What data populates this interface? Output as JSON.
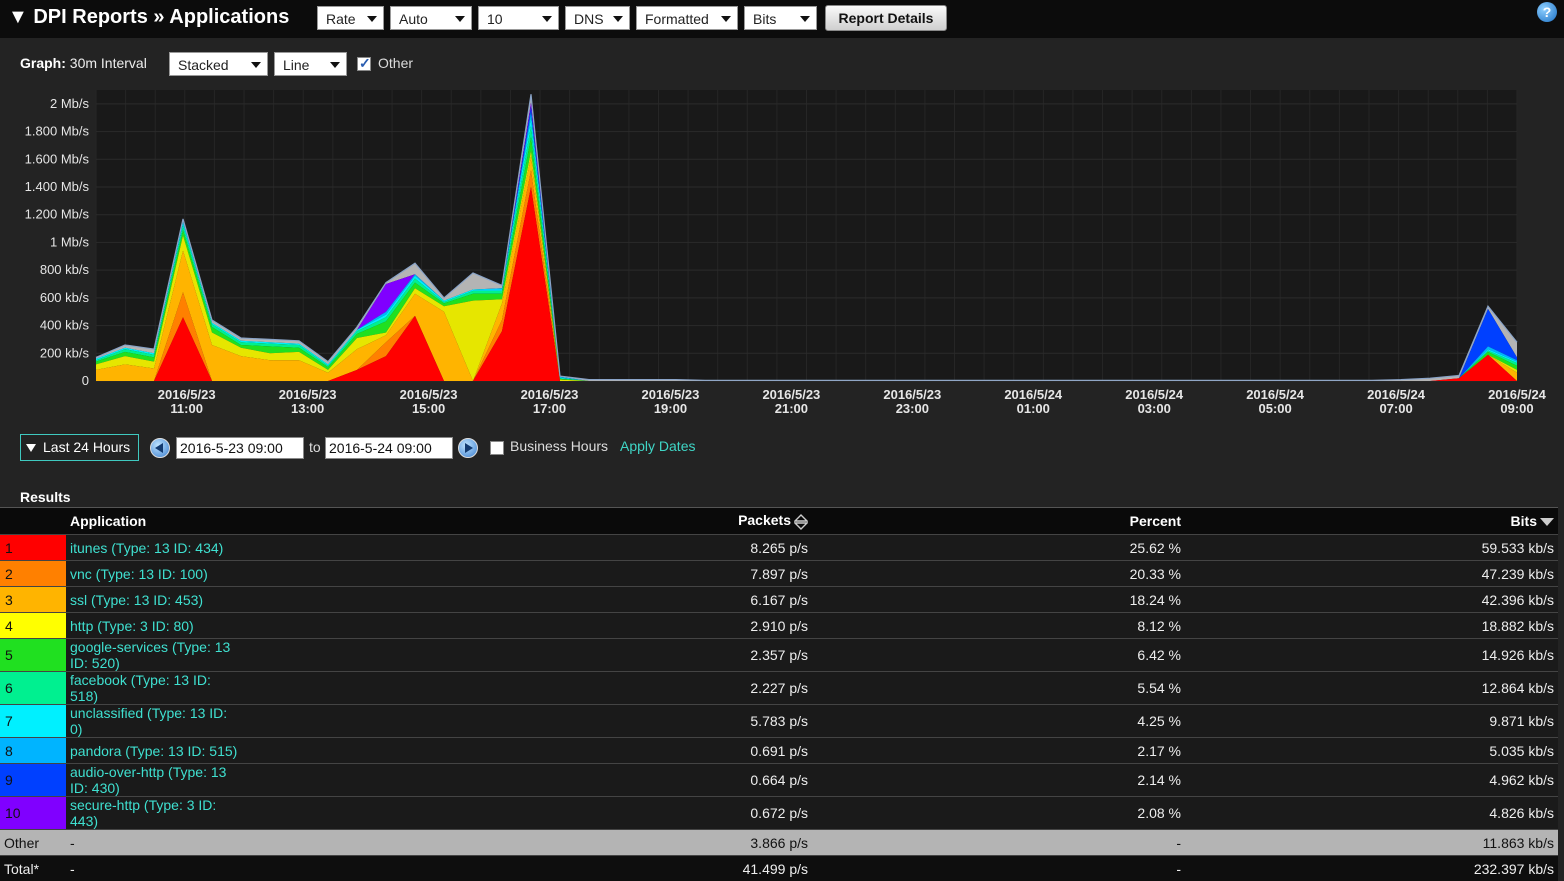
{
  "header": {
    "title": "▼ DPI Reports » Applications",
    "selects": [
      "Rate",
      "Auto",
      "10",
      "DNS",
      "Formatted",
      "Bits"
    ],
    "report_button": "Report Details",
    "help": "?"
  },
  "graph_controls": {
    "label": "Graph:",
    "interval": "30m Interval",
    "mode": "Stacked",
    "style": "Line",
    "other_checked": true,
    "other_label": "Other"
  },
  "chart_data": {
    "type": "area",
    "stacked": true,
    "y_unit": "bits/s",
    "ylim": [
      0,
      2100000
    ],
    "yticks": [
      "2 Mb/s",
      "1.800 Mb/s",
      "1.600 Mb/s",
      "1.400 Mb/s",
      "1.200 Mb/s",
      "1 Mb/s",
      "800 kb/s",
      "600 kb/s",
      "400 kb/s",
      "200 kb/s",
      "0"
    ],
    "ytick_values": [
      2000000,
      1800000,
      1600000,
      1400000,
      1200000,
      1000000,
      800000,
      600000,
      400000,
      200000,
      0
    ],
    "xticks": [
      {
        "date": "2016/5/23",
        "time": "11:00"
      },
      {
        "date": "2016/5/23",
        "time": "13:00"
      },
      {
        "date": "2016/5/23",
        "time": "15:00"
      },
      {
        "date": "2016/5/23",
        "time": "17:00"
      },
      {
        "date": "2016/5/23",
        "time": "19:00"
      },
      {
        "date": "2016/5/23",
        "time": "21:00"
      },
      {
        "date": "2016/5/23",
        "time": "23:00"
      },
      {
        "date": "2016/5/24",
        "time": "01:00"
      },
      {
        "date": "2016/5/24",
        "time": "03:00"
      },
      {
        "date": "2016/5/24",
        "time": "05:00"
      },
      {
        "date": "2016/5/24",
        "time": "07:00"
      },
      {
        "date": "2016/5/24",
        "time": "09:00"
      }
    ],
    "x_start": "2016-05-23 09:30",
    "x_end": "2016-05-24 09:00",
    "grid": true,
    "series": [
      {
        "name": "itunes",
        "color": "#ff0000",
        "values": [
          0,
          0,
          0,
          460000,
          0,
          0,
          0,
          0,
          0,
          80000,
          180000,
          470000,
          0,
          0,
          360000,
          1400000,
          0,
          0,
          0,
          0,
          0,
          0,
          0,
          0,
          0,
          0,
          0,
          0,
          0,
          0,
          0,
          0,
          0,
          0,
          0,
          0,
          0,
          0,
          0,
          0,
          0,
          0,
          0,
          0,
          0,
          0,
          0,
          20000,
          190000,
          0
        ]
      },
      {
        "name": "vnc",
        "color": "#ff8000",
        "values": [
          0,
          0,
          0,
          180000,
          0,
          0,
          0,
          0,
          0,
          0,
          100000,
          0,
          0,
          0,
          80000,
          120000,
          0,
          0,
          0,
          0,
          0,
          0,
          0,
          0,
          0,
          0,
          0,
          0,
          0,
          0,
          0,
          0,
          0,
          0,
          0,
          0,
          0,
          0,
          0,
          0,
          0,
          0,
          0,
          0,
          0,
          0,
          0,
          0,
          0,
          0
        ]
      },
      {
        "name": "ssl",
        "color": "#ffb400",
        "values": [
          80000,
          120000,
          90000,
          300000,
          260000,
          180000,
          150000,
          150000,
          60000,
          150000,
          50000,
          160000,
          500000,
          0,
          120000,
          100000,
          0,
          0,
          0,
          0,
          0,
          0,
          0,
          0,
          0,
          0,
          0,
          0,
          0,
          0,
          0,
          0,
          0,
          0,
          0,
          0,
          0,
          0,
          0,
          0,
          0,
          0,
          0,
          0,
          0,
          0,
          0,
          0,
          0,
          60000
        ]
      },
      {
        "name": "http",
        "color": "#e6e600",
        "values": [
          40000,
          60000,
          50000,
          110000,
          90000,
          60000,
          50000,
          60000,
          20000,
          80000,
          20000,
          40000,
          40000,
          580000,
          30000,
          40000,
          10000,
          0,
          0,
          0,
          0,
          0,
          0,
          0,
          0,
          0,
          0,
          0,
          0,
          0,
          0,
          0,
          0,
          0,
          0,
          0,
          0,
          0,
          0,
          0,
          0,
          0,
          0,
          0,
          0,
          0,
          0,
          0,
          0,
          20000
        ]
      },
      {
        "name": "google-services",
        "color": "#20e020",
        "values": [
          20000,
          30000,
          30000,
          40000,
          40000,
          20000,
          50000,
          30000,
          20000,
          30000,
          80000,
          40000,
          20000,
          50000,
          40000,
          100000,
          5000,
          0,
          0,
          0,
          0,
          0,
          0,
          0,
          0,
          0,
          0,
          0,
          0,
          0,
          0,
          0,
          0,
          0,
          0,
          0,
          0,
          0,
          0,
          0,
          0,
          0,
          0,
          0,
          0,
          0,
          0,
          0,
          20000,
          30000
        ]
      },
      {
        "name": "facebook",
        "color": "#00f090",
        "values": [
          10000,
          20000,
          20000,
          30000,
          20000,
          20000,
          20000,
          20000,
          10000,
          20000,
          30000,
          30000,
          10000,
          20000,
          20000,
          80000,
          5000,
          0,
          0,
          0,
          0,
          0,
          0,
          0,
          0,
          0,
          0,
          0,
          0,
          0,
          0,
          0,
          0,
          0,
          0,
          0,
          0,
          0,
          0,
          0,
          0,
          0,
          0,
          0,
          0,
          0,
          0,
          0,
          10000,
          20000
        ]
      },
      {
        "name": "unclassified",
        "color": "#00f0ff",
        "values": [
          10000,
          10000,
          10000,
          20000,
          10000,
          10000,
          10000,
          10000,
          10000,
          10000,
          20000,
          20000,
          10000,
          10000,
          10000,
          60000,
          5000,
          0,
          0,
          0,
          0,
          0,
          0,
          0,
          0,
          0,
          0,
          0,
          0,
          0,
          0,
          0,
          0,
          0,
          0,
          0,
          0,
          0,
          0,
          0,
          0,
          0,
          0,
          0,
          0,
          0,
          0,
          0,
          10000,
          10000
        ]
      },
      {
        "name": "pandora",
        "color": "#00b4ff",
        "values": [
          0,
          0,
          0,
          10000,
          0,
          0,
          0,
          0,
          0,
          0,
          20000,
          10000,
          0,
          0,
          10000,
          40000,
          5000,
          0,
          0,
          0,
          0,
          0,
          0,
          0,
          0,
          0,
          0,
          0,
          0,
          0,
          0,
          0,
          0,
          0,
          0,
          0,
          0,
          0,
          0,
          0,
          0,
          0,
          0,
          0,
          0,
          0,
          0,
          0,
          20000,
          10000
        ]
      },
      {
        "name": "audio-over-http",
        "color": "#0040ff",
        "values": [
          0,
          0,
          0,
          0,
          0,
          0,
          0,
          0,
          0,
          0,
          0,
          0,
          0,
          0,
          0,
          40000,
          0,
          0,
          0,
          0,
          0,
          0,
          0,
          0,
          0,
          0,
          0,
          0,
          0,
          0,
          0,
          0,
          0,
          0,
          0,
          0,
          0,
          0,
          0,
          0,
          0,
          0,
          0,
          0,
          0,
          0,
          0,
          0,
          270000,
          20000
        ]
      },
      {
        "name": "secure-http",
        "color": "#8000ff",
        "values": [
          0,
          0,
          0,
          0,
          0,
          0,
          0,
          0,
          0,
          0,
          200000,
          0,
          0,
          0,
          0,
          30000,
          0,
          0,
          0,
          0,
          0,
          0,
          0,
          0,
          0,
          0,
          0,
          0,
          0,
          0,
          0,
          0,
          0,
          0,
          0,
          0,
          0,
          0,
          0,
          0,
          0,
          0,
          0,
          0,
          0,
          0,
          0,
          0,
          0,
          0
        ]
      },
      {
        "name": "Other",
        "color": "#b4b4b4",
        "values": [
          10000,
          20000,
          30000,
          20000,
          20000,
          20000,
          20000,
          20000,
          20000,
          20000,
          10000,
          80000,
          20000,
          120000,
          20000,
          60000,
          5000,
          10000,
          10000,
          10000,
          10000,
          5000,
          5000,
          5000,
          5000,
          5000,
          5000,
          5000,
          5000,
          5000,
          5000,
          5000,
          5000,
          5000,
          5000,
          5000,
          5000,
          5000,
          5000,
          5000,
          5000,
          5000,
          5000,
          5000,
          5000,
          10000,
          20000,
          20000,
          20000,
          110000
        ]
      }
    ]
  },
  "date_controls": {
    "range": "Last 24 Hours",
    "from": "2016-5-23 09:00",
    "to_label": "to",
    "to": "2016-5-24 09:00",
    "business_hours_label": "Business Hours",
    "business_hours_checked": false,
    "apply": "Apply Dates"
  },
  "results": {
    "heading": "Results",
    "columns": {
      "application": "Application",
      "packets": "Packets",
      "percent": "Percent",
      "bits": "Bits"
    },
    "rows": [
      {
        "rank": "1",
        "color": "#ff0000",
        "app": "itunes (Type: 13 ID: 434)",
        "packets": "8.265 p/s",
        "percent": "25.62 %",
        "bits": "59.533 kb/s"
      },
      {
        "rank": "2",
        "color": "#ff8000",
        "app": "vnc (Type: 13 ID: 100)",
        "packets": "7.897 p/s",
        "percent": "20.33 %",
        "bits": "47.239 kb/s"
      },
      {
        "rank": "3",
        "color": "#ffb400",
        "app": "ssl (Type: 13 ID: 453)",
        "packets": "6.167 p/s",
        "percent": "18.24 %",
        "bits": "42.396 kb/s"
      },
      {
        "rank": "4",
        "color": "#ffff00",
        "app": "http (Type: 3 ID: 80)",
        "packets": "2.910 p/s",
        "percent": "8.12 %",
        "bits": "18.882 kb/s"
      },
      {
        "rank": "5",
        "color": "#20e020",
        "app": "google-services (Type: 13 ID: 520)",
        "packets": "2.357 p/s",
        "percent": "6.42 %",
        "bits": "14.926 kb/s"
      },
      {
        "rank": "6",
        "color": "#00f090",
        "app": "facebook (Type: 13 ID: 518)",
        "packets": "2.227 p/s",
        "percent": "5.54 %",
        "bits": "12.864 kb/s"
      },
      {
        "rank": "7",
        "color": "#00f0ff",
        "app": "unclassified (Type: 13 ID: 0)",
        "packets": "5.783 p/s",
        "percent": "4.25 %",
        "bits": "9.871 kb/s"
      },
      {
        "rank": "8",
        "color": "#00b4ff",
        "app": "pandora (Type: 13 ID: 515)",
        "packets": "0.691 p/s",
        "percent": "2.17 %",
        "bits": "5.035 kb/s"
      },
      {
        "rank": "9",
        "color": "#0040ff",
        "app": "audio-over-http (Type: 13 ID: 430)",
        "packets": "0.664 p/s",
        "percent": "2.14 %",
        "bits": "4.962 kb/s"
      },
      {
        "rank": "10",
        "color": "#8000ff",
        "app": "secure-http (Type: 3 ID: 443)",
        "packets": "0.672 p/s",
        "percent": "2.08 %",
        "bits": "4.826 kb/s"
      }
    ],
    "other": {
      "label": "Other",
      "app": "-",
      "packets": "3.866 p/s",
      "percent": "-",
      "bits": "11.863 kb/s"
    },
    "total": {
      "label": "Total*",
      "app": "-",
      "packets": "41.499 p/s",
      "percent": "-",
      "bits": "232.397 kb/s"
    }
  }
}
